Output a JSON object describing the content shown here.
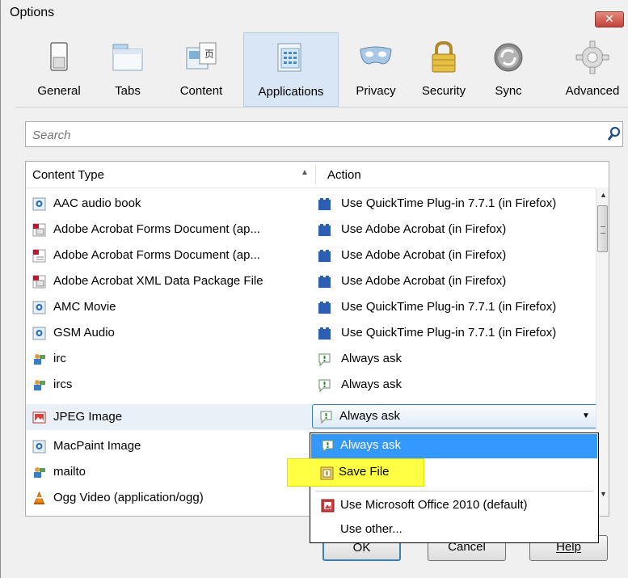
{
  "window": {
    "title": "Options",
    "close_symbol": "✕"
  },
  "toolbar": {
    "items": [
      {
        "label": "General",
        "icon": "switch-icon"
      },
      {
        "label": "Tabs",
        "icon": "tabs-icon"
      },
      {
        "label": "Content",
        "icon": "content-icon"
      },
      {
        "label": "Applications",
        "icon": "applications-icon",
        "active": true
      },
      {
        "label": "Privacy",
        "icon": "mask-icon"
      },
      {
        "label": "Security",
        "icon": "padlock-icon"
      },
      {
        "label": "Sync",
        "icon": "sync-icon"
      },
      {
        "label": "Advanced",
        "icon": "gear-icon"
      }
    ]
  },
  "search": {
    "placeholder": "Search",
    "value": ""
  },
  "list": {
    "header_content_type": "Content Type",
    "header_sort": "▲",
    "header_action": "Action",
    "rows": [
      {
        "content_type": "AAC audio book",
        "action": "Use QuickTime Plug-in 7.7.1 (in Firefox)"
      },
      {
        "content_type": "Adobe Acrobat Forms Document (ap...",
        "action": "Use Adobe Acrobat (in Firefox)"
      },
      {
        "content_type": "Adobe Acrobat Forms Document (ap...",
        "action": "Use Adobe Acrobat (in Firefox)"
      },
      {
        "content_type": "Adobe Acrobat XML Data Package File",
        "action": "Use Adobe Acrobat (in Firefox)"
      },
      {
        "content_type": "AMC Movie",
        "action": "Use QuickTime Plug-in 7.7.1 (in Firefox)"
      },
      {
        "content_type": "GSM Audio",
        "action": "Use QuickTime Plug-in 7.7.1 (in Firefox)"
      },
      {
        "content_type": "irc",
        "action": "Always ask"
      },
      {
        "content_type": "ircs",
        "action": "Always ask"
      },
      {
        "content_type": "JPEG Image",
        "action": "Always ask"
      },
      {
        "content_type": "MacPaint Image",
        "action": ""
      },
      {
        "content_type": "mailto",
        "action": ""
      },
      {
        "content_type": "Ogg Video (application/ogg)",
        "action": ""
      }
    ],
    "selected_action": "Always ask",
    "dropdown_arrow": "▼"
  },
  "dropdown": {
    "items": [
      {
        "label": "Always ask"
      },
      {
        "label": "Save File"
      },
      {
        "label": "Use Microsoft Office 2010 (default)"
      },
      {
        "label": "Use other..."
      }
    ]
  },
  "buttons": {
    "ok": "OK",
    "cancel": "Cancel",
    "help": "Help"
  },
  "colors": {
    "highlight_yellow": "#ffff44",
    "selection_blue": "#3399ff",
    "active_tab": "#d9e6f5"
  }
}
